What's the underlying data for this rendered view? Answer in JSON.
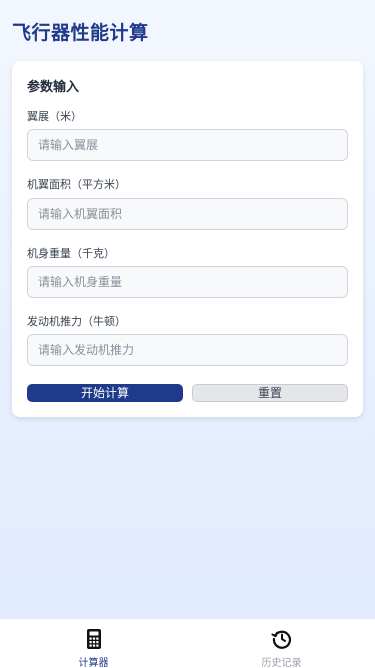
{
  "header": {
    "title": "飞行器性能计算"
  },
  "card": {
    "title": "参数输入",
    "fields": [
      {
        "label": "翼展（米）",
        "placeholder": "请输入翼展",
        "value": ""
      },
      {
        "label": "机翼面积（平方米）",
        "placeholder": "请输入机翼面积",
        "value": ""
      },
      {
        "label": "机身重量（千克）",
        "placeholder": "请输入机身重量",
        "value": ""
      },
      {
        "label": "发动机推力（牛顿）",
        "placeholder": "请输入发动机推力",
        "value": ""
      }
    ],
    "buttons": {
      "calculate": "开始计算",
      "reset": "重置"
    }
  },
  "tabbar": {
    "items": [
      {
        "label": "计算器",
        "icon": "calculator-icon",
        "active": true
      },
      {
        "label": "历史记录",
        "icon": "history-icon",
        "active": false
      }
    ]
  },
  "colors": {
    "accent": "#1f3a8a",
    "inactive_tab": "#9aa0aa",
    "background": "#e9f1ff"
  }
}
